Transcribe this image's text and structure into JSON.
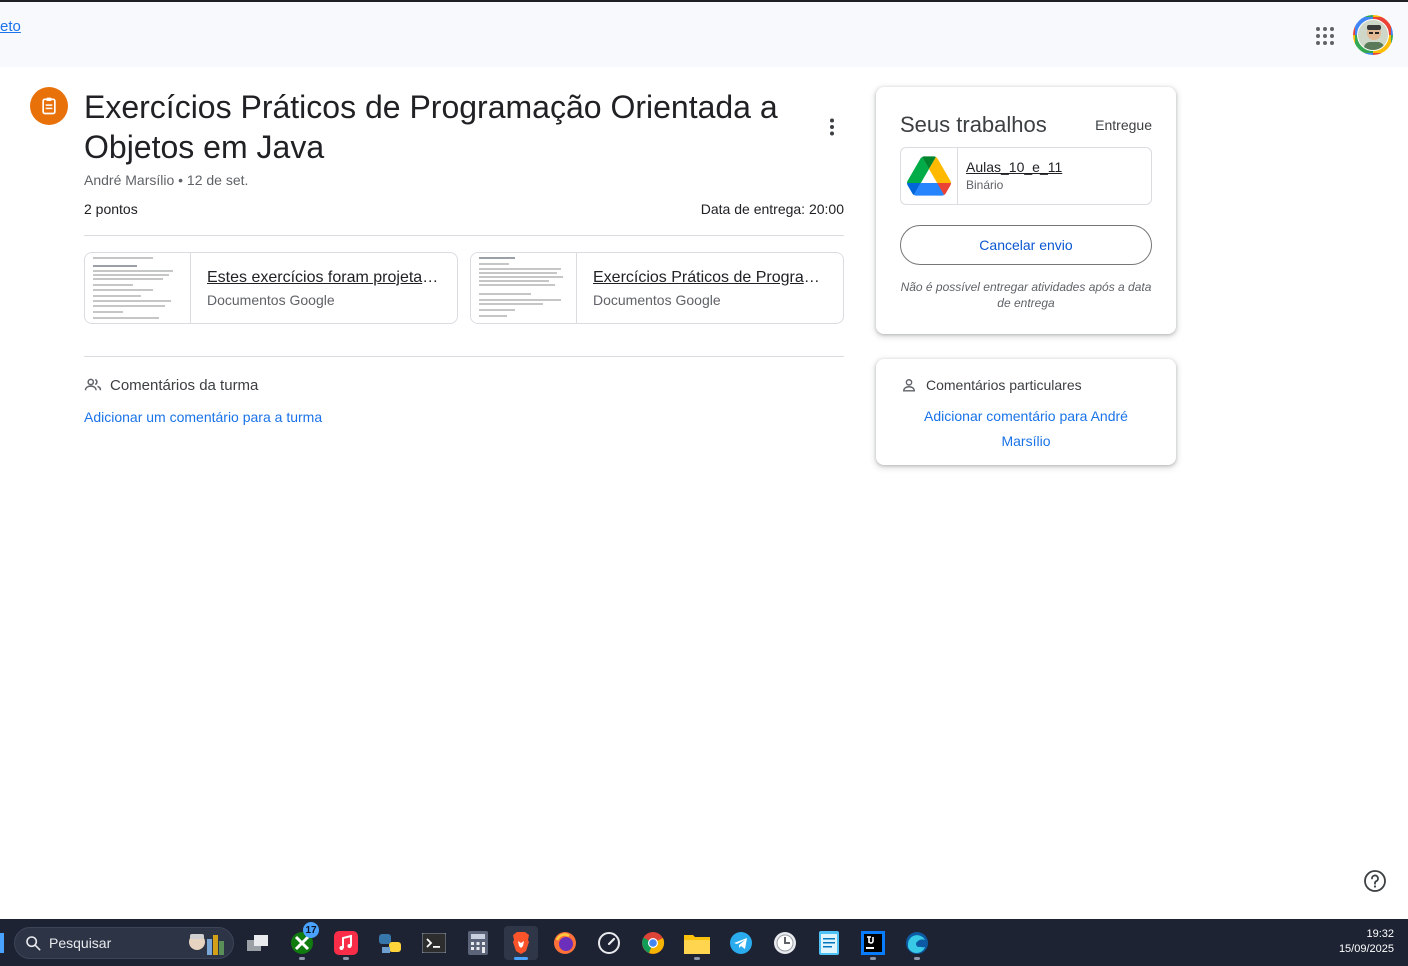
{
  "header": {
    "crumb_link": "eto",
    "apps_icon": "google-apps-grid-icon",
    "avatar": "user-avatar"
  },
  "assignment": {
    "icon": "assignment-clipboard-icon",
    "title": "Exercícios Práticos de Programação Orientada a Objetos em Java",
    "author_date": "André Marsílio • 12 de set.",
    "points": "2 pontos",
    "due": "Data de entrega: 20:00",
    "attachments": [
      {
        "name": "Estes exercícios foram projetados para reforçar conceitos",
        "type": "Documentos Google"
      },
      {
        "name": "Exercícios Práticos de Programação Orientada a Objetos",
        "type": "Documentos Google"
      }
    ]
  },
  "class_comments": {
    "heading": "Comentários da turma",
    "add_link": "Adicionar um comentário para a turma"
  },
  "your_work": {
    "title": "Seus trabalhos",
    "status": "Entregue",
    "file_name": "Aulas_10_e_11",
    "file_type": "Binário",
    "cancel_button": "Cancelar envio",
    "note": "Não é possível entregar atividades após a data de entrega"
  },
  "private_comments": {
    "heading": "Comentários particulares",
    "add_link": "Adicionar comentário para André Marsílio"
  },
  "taskbar": {
    "search_placeholder": "Pesquisar",
    "xbox_badge": "17",
    "time": "19:32",
    "date": "15/09/2025",
    "apps": [
      "task-view",
      "xbox",
      "apple-music",
      "python",
      "terminal",
      "calculator",
      "brave",
      "firefox",
      "speedometer",
      "chrome",
      "file-explorer",
      "telegram",
      "clock-app",
      "notepad",
      "jetbrains-ide",
      "edge"
    ]
  },
  "colors": {
    "accent_orange": "#e8710a",
    "link_blue": "#1a73e8",
    "taskbar_bg": "#1d2333"
  }
}
